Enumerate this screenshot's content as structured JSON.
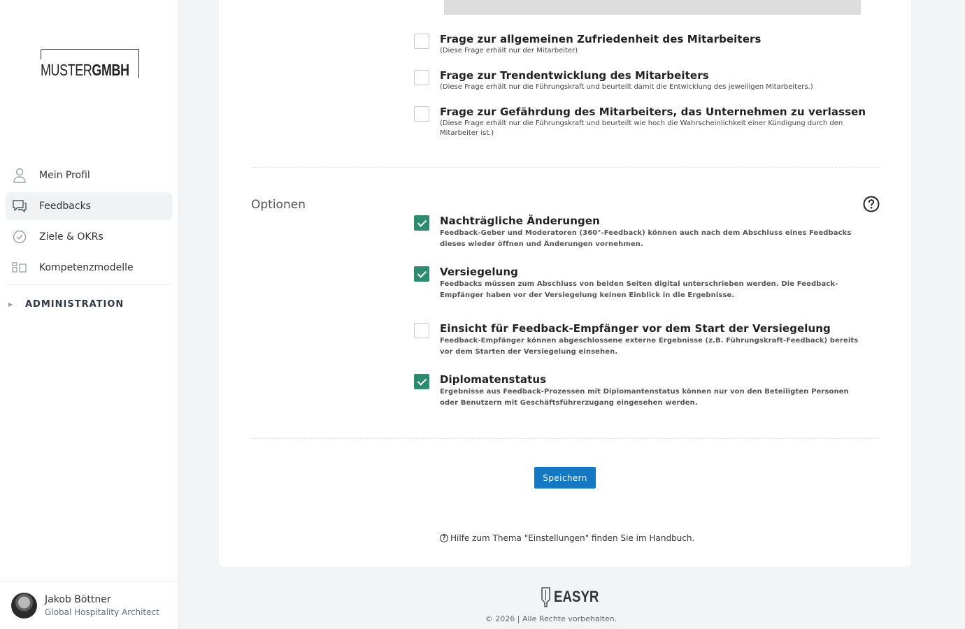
{
  "logo": {
    "part1": "MUSTER",
    "part2": "GMBH"
  },
  "nav": {
    "items": [
      {
        "label": "Mein Profil",
        "icon": "user-icon"
      },
      {
        "label": "Feedbacks",
        "icon": "chat-icon"
      },
      {
        "label": "Ziele & OKRs",
        "icon": "check-circle-icon"
      },
      {
        "label": "Kompetenzmodelle",
        "icon": "grid-icon"
      }
    ],
    "admin_label": "ADMINISTRATION"
  },
  "user": {
    "name": "Jakob Böttner",
    "role": "Global Hospitality Architect"
  },
  "questions": [
    {
      "title": "Frage zur allgemeinen Zufriedenheit des Mitarbeiters",
      "note": "(Diese Frage erhält nur der Mitarbeiter)",
      "checked": false
    },
    {
      "title": "Frage zur Trendentwicklung des Mitarbeiters",
      "note": "(Diese Frage erhält nur die Führungskraft und beurteilt damit die Entwicklung des jeweiligen Mitarbeiters.)",
      "checked": false
    },
    {
      "title": "Frage zur Gefährdung des Mitarbeiters, das Unternehmen zu verlassen",
      "note": "(Diese Frage erhält nur die Führungskraft und beurteilt wie hoch die Wahrscheinlichkeit einer Kündigung durch den Mitarbeiter ist.)",
      "checked": false
    }
  ],
  "options": {
    "section_label": "Optionen",
    "items": [
      {
        "title": "Nachträgliche Änderungen",
        "desc": "Feedback-Geber und Moderatoren (360°-Feedback) können auch nach dem Abschluss eines Feedbacks dieses wieder öffnen und Änderungen vornehmen.",
        "checked": true
      },
      {
        "title": "Versiegelung",
        "desc": "Feedbacks müssen zum Abschluss von beiden Seiten digital unterschrieben werden. Die Feedback-Empfänger haben vor der Versiegelung keinen Einblick in die Ergebnisse.",
        "checked": true
      },
      {
        "title": "Einsicht für Feedback-Empfänger vor dem Start der Versiegelung",
        "desc": "Feedback-Empfänger können abgeschlossene externe Ergebnisse (z.B. Führungskraft-Feedback) bereits vor dem Starten der Versiegelung einsehen.",
        "checked": false
      },
      {
        "title": "Diplomatenstatus",
        "desc": "Ergebnisse aus Feedback-Prozessen mit Diplomantenstatus können nur von den Beteiligten Personen oder Benutzern mit Geschäftsführerzugang eingesehen werden.",
        "checked": true
      }
    ]
  },
  "save_label": "Speichern",
  "hint_text": "Hilfe zum Thema \"Einstellungen\" finden Sie im Handbuch.",
  "footer": {
    "brand": "EASYR",
    "copyright": "© 2026 | Alle Rechte vorbehalten."
  },
  "colors": {
    "accent": "#1478c2",
    "checkbox_checked": "#2e8b6f"
  }
}
